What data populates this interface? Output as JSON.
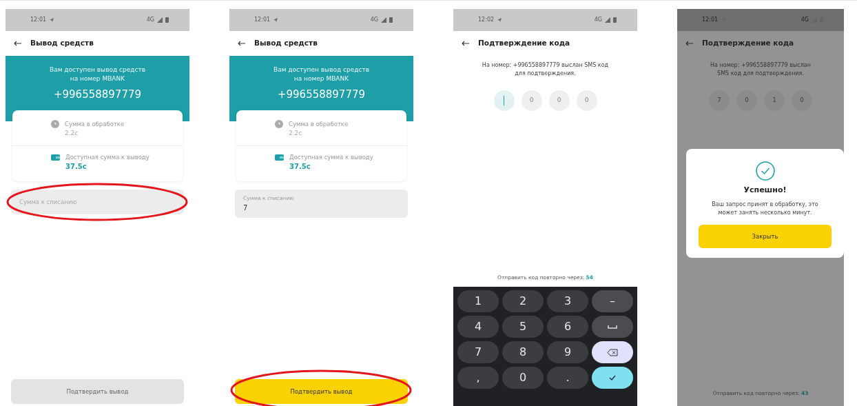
{
  "screens": [
    {
      "kind": "withdraw",
      "status": {
        "time": "12:01",
        "network": "4G"
      },
      "title": "Вывод средств",
      "banner": {
        "text": "Вам доступен вывод средств",
        "subtext": "на номер MBANK",
        "phone": "+996558897779"
      },
      "balances": [
        {
          "kind": "pending",
          "label": "Сумма в обработке",
          "amount": "2.2с"
        },
        {
          "kind": "available",
          "label": "Доступная сумма к выводу",
          "amount": "37.5с"
        }
      ],
      "field": {
        "placeholder": "Сумма к списанию",
        "highlighted": true
      },
      "button": {
        "label": "Подтвердить вывод",
        "disabled": true,
        "highlighted": false
      }
    },
    {
      "kind": "withdraw",
      "status": {
        "time": "12:01",
        "network": "4G"
      },
      "title": "Вывод средств",
      "banner": {
        "text": "Вам доступен вывод средств",
        "subtext": "на номер MBANK",
        "phone": "+996558897779"
      },
      "balances": [
        {
          "kind": "pending",
          "label": "Сумма в обработке",
          "amount": "2.2с"
        },
        {
          "kind": "available",
          "label": "Доступная сумма к выводу",
          "amount": "37.5с"
        }
      ],
      "field": {
        "label": "Сумма к списанию",
        "value": "7",
        "highlighted": false
      },
      "button": {
        "label": "Подтвердить вывод",
        "disabled": false,
        "highlighted": true
      }
    },
    {
      "kind": "code",
      "dimmed": false,
      "status": {
        "time": "12:02",
        "network": "4G"
      },
      "title": "Подтверждение кода",
      "message": "На номер: +996558897779 выслан SMS код для подтверждения.",
      "code": [
        {
          "focused": true
        },
        {
          "placeholder": "0",
          "focused": false
        },
        {
          "placeholder": "0",
          "focused": false
        },
        {
          "placeholder": "0",
          "focused": false
        }
      ],
      "resend": {
        "text": "Отправить код повторно через:",
        "seconds": "54"
      },
      "keypad": [
        {
          "kind": "digit",
          "label": "1"
        },
        {
          "kind": "digit",
          "label": "2"
        },
        {
          "kind": "digit",
          "label": "3"
        },
        {
          "kind": "symbol",
          "label": "–"
        },
        {
          "kind": "digit",
          "label": "4"
        },
        {
          "kind": "digit",
          "label": "5"
        },
        {
          "kind": "digit",
          "label": "6"
        },
        {
          "kind": "space"
        },
        {
          "kind": "digit",
          "label": "7"
        },
        {
          "kind": "digit",
          "label": "8"
        },
        {
          "kind": "digit",
          "label": "9"
        },
        {
          "kind": "backspace"
        },
        {
          "kind": "digit",
          "label": ","
        },
        {
          "kind": "digit",
          "label": "0"
        },
        {
          "kind": "digit",
          "label": "."
        },
        {
          "kind": "done"
        }
      ]
    },
    {
      "kind": "code",
      "dimmed": true,
      "status": {
        "time": "12:01",
        "network": "4G"
      },
      "title": "Подтверждение кода",
      "message": "На номер: +996558897779 выслан SMS код для подтверждения.",
      "code": [
        {
          "digit": "7",
          "focused": false
        },
        {
          "digit": "0",
          "focused": false
        },
        {
          "digit": "1",
          "focused": false
        },
        {
          "digit": "0",
          "focused": false
        }
      ],
      "resend": {
        "text": "Отправить код повторно через:",
        "seconds": "43"
      },
      "dialog": {
        "title": "Успешно!",
        "message": "Ваш запрос принят в обработку, это может занять несколько минут.",
        "button": "Закрыть"
      }
    }
  ]
}
